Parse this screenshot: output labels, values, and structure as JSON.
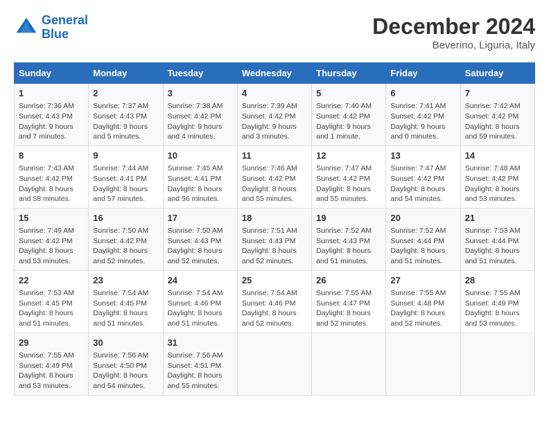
{
  "header": {
    "logo_line1": "General",
    "logo_line2": "Blue",
    "month_title": "December 2024",
    "subtitle": "Beverino, Liguria, Italy"
  },
  "weekdays": [
    "Sunday",
    "Monday",
    "Tuesday",
    "Wednesday",
    "Thursday",
    "Friday",
    "Saturday"
  ],
  "weeks": [
    [
      {
        "day": "1",
        "info": "Sunrise: 7:36 AM\nSunset: 4:43 PM\nDaylight: 9 hours and 7 minutes."
      },
      {
        "day": "2",
        "info": "Sunrise: 7:37 AM\nSunset: 4:43 PM\nDaylight: 9 hours and 5 minutes."
      },
      {
        "day": "3",
        "info": "Sunrise: 7:38 AM\nSunset: 4:42 PM\nDaylight: 9 hours and 4 minutes."
      },
      {
        "day": "4",
        "info": "Sunrise: 7:39 AM\nSunset: 4:42 PM\nDaylight: 9 hours and 3 minutes."
      },
      {
        "day": "5",
        "info": "Sunrise: 7:40 AM\nSunset: 4:42 PM\nDaylight: 9 hours and 1 minute."
      },
      {
        "day": "6",
        "info": "Sunrise: 7:41 AM\nSunset: 4:42 PM\nDaylight: 9 hours and 0 minutes."
      },
      {
        "day": "7",
        "info": "Sunrise: 7:42 AM\nSunset: 4:42 PM\nDaylight: 8 hours and 59 minutes."
      }
    ],
    [
      {
        "day": "8",
        "info": "Sunrise: 7:43 AM\nSunset: 4:42 PM\nDaylight: 8 hours and 58 minutes."
      },
      {
        "day": "9",
        "info": "Sunrise: 7:44 AM\nSunset: 4:41 PM\nDaylight: 8 hours and 57 minutes."
      },
      {
        "day": "10",
        "info": "Sunrise: 7:45 AM\nSunset: 4:41 PM\nDaylight: 8 hours and 56 minutes."
      },
      {
        "day": "11",
        "info": "Sunrise: 7:46 AM\nSunset: 4:42 PM\nDaylight: 8 hours and 55 minutes."
      },
      {
        "day": "12",
        "info": "Sunrise: 7:47 AM\nSunset: 4:42 PM\nDaylight: 8 hours and 55 minutes."
      },
      {
        "day": "13",
        "info": "Sunrise: 7:47 AM\nSunset: 4:42 PM\nDaylight: 8 hours and 54 minutes."
      },
      {
        "day": "14",
        "info": "Sunrise: 7:48 AM\nSunset: 4:42 PM\nDaylight: 8 hours and 53 minutes."
      }
    ],
    [
      {
        "day": "15",
        "info": "Sunrise: 7:49 AM\nSunset: 4:42 PM\nDaylight: 8 hours and 53 minutes."
      },
      {
        "day": "16",
        "info": "Sunrise: 7:50 AM\nSunset: 4:42 PM\nDaylight: 8 hours and 52 minutes."
      },
      {
        "day": "17",
        "info": "Sunrise: 7:50 AM\nSunset: 4:43 PM\nDaylight: 8 hours and 52 minutes."
      },
      {
        "day": "18",
        "info": "Sunrise: 7:51 AM\nSunset: 4:43 PM\nDaylight: 8 hours and 52 minutes."
      },
      {
        "day": "19",
        "info": "Sunrise: 7:52 AM\nSunset: 4:43 PM\nDaylight: 8 hours and 51 minutes."
      },
      {
        "day": "20",
        "info": "Sunrise: 7:52 AM\nSunset: 4:44 PM\nDaylight: 8 hours and 51 minutes."
      },
      {
        "day": "21",
        "info": "Sunrise: 7:53 AM\nSunset: 4:44 PM\nDaylight: 8 hours and 51 minutes."
      }
    ],
    [
      {
        "day": "22",
        "info": "Sunrise: 7:53 AM\nSunset: 4:45 PM\nDaylight: 8 hours and 51 minutes."
      },
      {
        "day": "23",
        "info": "Sunrise: 7:54 AM\nSunset: 4:45 PM\nDaylight: 8 hours and 51 minutes."
      },
      {
        "day": "24",
        "info": "Sunrise: 7:54 AM\nSunset: 4:46 PM\nDaylight: 8 hours and 51 minutes."
      },
      {
        "day": "25",
        "info": "Sunrise: 7:54 AM\nSunset: 4:46 PM\nDaylight: 8 hours and 52 minutes."
      },
      {
        "day": "26",
        "info": "Sunrise: 7:55 AM\nSunset: 4:47 PM\nDaylight: 8 hours and 52 minutes."
      },
      {
        "day": "27",
        "info": "Sunrise: 7:55 AM\nSunset: 4:48 PM\nDaylight: 8 hours and 52 minutes."
      },
      {
        "day": "28",
        "info": "Sunrise: 7:55 AM\nSunset: 4:49 PM\nDaylight: 8 hours and 53 minutes."
      }
    ],
    [
      {
        "day": "29",
        "info": "Sunrise: 7:55 AM\nSunset: 4:49 PM\nDaylight: 8 hours and 53 minutes."
      },
      {
        "day": "30",
        "info": "Sunrise: 7:56 AM\nSunset: 4:50 PM\nDaylight: 8 hours and 54 minutes."
      },
      {
        "day": "31",
        "info": "Sunrise: 7:56 AM\nSunset: 4:51 PM\nDaylight: 8 hours and 55 minutes."
      },
      null,
      null,
      null,
      null
    ]
  ]
}
